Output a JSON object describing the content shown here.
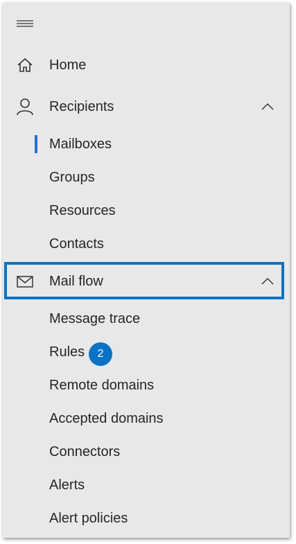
{
  "nav": {
    "menu_icon": "hamburger-icon",
    "items": [
      {
        "label": "Home",
        "icon": "home-icon"
      },
      {
        "label": "Recipients",
        "icon": "person-icon",
        "expanded": true,
        "children": [
          "Mailboxes",
          "Groups",
          "Resources",
          "Contacts"
        ],
        "selected_child": "Mailboxes"
      },
      {
        "label": "Mail flow",
        "icon": "mail-icon",
        "expanded": true,
        "highlighted": true,
        "children": [
          "Message trace",
          "Rules",
          "Remote domains",
          "Accepted domains",
          "Connectors",
          "Alerts",
          "Alert policies"
        ]
      }
    ],
    "rules_badge": "2"
  },
  "colors": {
    "panel_bg": "#e8e8e8",
    "accent": "#2b6ed6",
    "highlight_border": "#0a73c4",
    "badge_bg": "#0a73c4"
  }
}
